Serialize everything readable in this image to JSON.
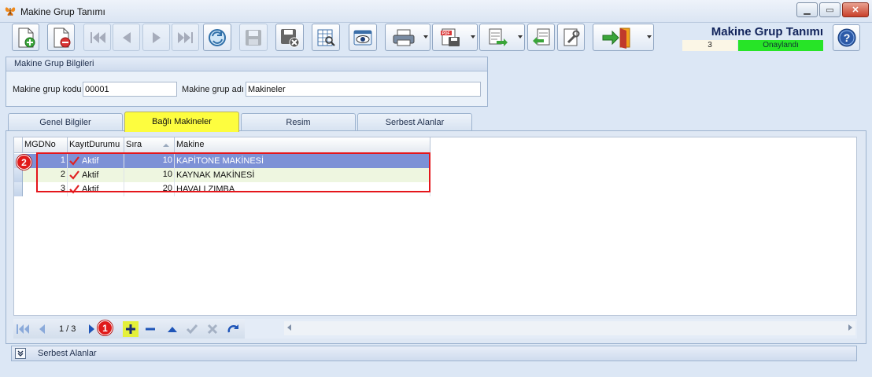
{
  "window": {
    "title": "Makine Grup Tanımı",
    "controls": [
      "minimize",
      "maximize",
      "close"
    ]
  },
  "toolbar": {
    "buttons": [
      {
        "id": "new",
        "icon": "new-document-icon",
        "enabled": true
      },
      {
        "id": "delete",
        "icon": "delete-document-icon",
        "enabled": true
      },
      {
        "id": "first",
        "icon": "first-record-icon",
        "enabled": false
      },
      {
        "id": "prev",
        "icon": "previous-record-icon",
        "enabled": false
      },
      {
        "id": "next",
        "icon": "next-record-icon",
        "enabled": false
      },
      {
        "id": "last",
        "icon": "last-record-icon",
        "enabled": false
      },
      {
        "id": "refresh",
        "icon": "refresh-icon",
        "enabled": true
      },
      {
        "id": "save",
        "icon": "save-icon",
        "enabled": false
      },
      {
        "id": "cancel",
        "icon": "save-cancel-icon",
        "enabled": true
      },
      {
        "id": "report",
        "icon": "report-preview-icon",
        "enabled": true
      },
      {
        "id": "view",
        "icon": "view-eye-icon",
        "enabled": true
      },
      {
        "id": "print",
        "icon": "printer-icon",
        "enabled": true,
        "dropdown": true
      },
      {
        "id": "pdf",
        "icon": "pdf-export-icon",
        "enabled": true,
        "dropdown": true
      },
      {
        "id": "export",
        "icon": "document-export-icon",
        "enabled": true,
        "dropdown": true
      },
      {
        "id": "import",
        "icon": "document-import-icon",
        "enabled": true
      },
      {
        "id": "tools",
        "icon": "tools-icon",
        "enabled": true
      },
      {
        "id": "exit",
        "icon": "exit-door-icon",
        "enabled": true,
        "dropdown": true
      }
    ]
  },
  "header": {
    "module_title": "Makine Grup Tanımı",
    "record_count": "3",
    "status": "Onaylandı",
    "status_color": "#27e427"
  },
  "group": {
    "title": "Makine Grup Bilgileri",
    "code_label": "Makine grup kodu",
    "code_value": "00001",
    "name_label": "Makine grup adı",
    "name_value": "Makineler"
  },
  "tabs": [
    {
      "label": "Genel Bilgiler",
      "active": false
    },
    {
      "label": "Bağlı Makineler",
      "active": true
    },
    {
      "label": "Resim",
      "active": false
    },
    {
      "label": "Serbest Alanlar",
      "active": false
    }
  ],
  "grid": {
    "columns": [
      "MGDNo",
      "KayıtDurumu",
      "Sıra",
      "Makine"
    ],
    "rows": [
      {
        "mgdno": "1",
        "durum": "Aktif",
        "sira": "10",
        "makine": "KAPİTONE MAKİNESİ",
        "selected": true
      },
      {
        "mgdno": "2",
        "durum": "Aktif",
        "sira": "10",
        "makine": "KAYNAK MAKİNESİ",
        "selected": false
      },
      {
        "mgdno": "3",
        "durum": "Aktif",
        "sira": "20",
        "makine": "HAVALI ZIMBA",
        "selected": false
      }
    ]
  },
  "navigator": {
    "page_info": "1 / 3"
  },
  "annotations": {
    "badge_add": "1",
    "badge_rows": "2",
    "highlight_color": "#e5161b"
  },
  "bottom": {
    "label": "Serbest Alanlar"
  }
}
